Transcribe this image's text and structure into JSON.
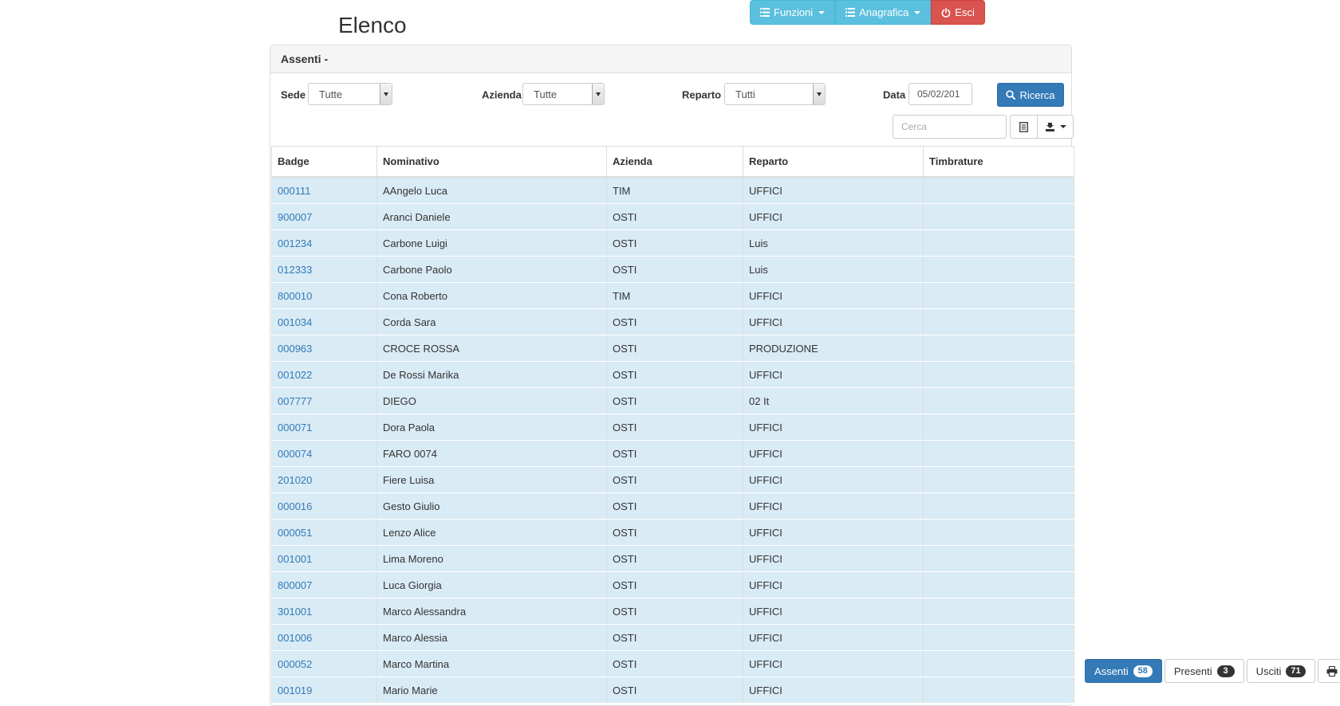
{
  "nav": {
    "funzioni_label": "Funzioni",
    "anagrafica_label": "Anagrafica",
    "esci_label": "Esci"
  },
  "page": {
    "title": "Elenco"
  },
  "panel": {
    "heading": "Assenti -"
  },
  "filters": {
    "sede_label": "Sede",
    "sede_value": "Tutte",
    "azienda_label": "Azienda",
    "azienda_value": "Tutte",
    "reparto_label": "Reparto",
    "reparto_value": "Tutti",
    "data_label": "Data",
    "data_value": "05/02/201",
    "search_button": "Ricerca",
    "cerca_placeholder": "Cerca"
  },
  "table": {
    "columns": [
      "Badge",
      "Nominativo",
      "Azienda",
      "Reparto",
      "Timbrature"
    ],
    "rows": [
      [
        "000111",
        "AAngelo Luca",
        "TIM",
        "UFFICI",
        ""
      ],
      [
        "900007",
        "Aranci Daniele",
        "OSTI",
        "UFFICI",
        ""
      ],
      [
        "001234",
        "Carbone Luigi",
        "OSTI",
        "Luis",
        ""
      ],
      [
        "012333",
        "Carbone Paolo",
        "OSTI",
        "Luis",
        ""
      ],
      [
        "800010",
        "Cona Roberto",
        "TIM",
        "UFFICI",
        ""
      ],
      [
        "001034",
        "Corda Sara",
        "OSTI",
        "UFFICI",
        ""
      ],
      [
        "000963",
        "CROCE ROSSA",
        "OSTI",
        "PRODUZIONE",
        ""
      ],
      [
        "001022",
        "De Rossi Marika",
        "OSTI",
        "UFFICI",
        ""
      ],
      [
        "007777",
        "DIEGO",
        "OSTI",
        "02 It",
        ""
      ],
      [
        "000071",
        "Dora Paola",
        "OSTI",
        "UFFICI",
        ""
      ],
      [
        "000074",
        "FARO 0074",
        "OSTI",
        "UFFICI",
        ""
      ],
      [
        "201020",
        "Fiere Luisa",
        "OSTI",
        "UFFICI",
        ""
      ],
      [
        "000016",
        "Gesto Giulio",
        "OSTI",
        "UFFICI",
        ""
      ],
      [
        "000051",
        "Lenzo Alice",
        "OSTI",
        "UFFICI",
        ""
      ],
      [
        "001001",
        "Lima Moreno",
        "OSTI",
        "UFFICI",
        ""
      ],
      [
        "800007",
        "Luca Giorgia",
        "OSTI",
        "UFFICI",
        ""
      ],
      [
        "301001",
        "Marco Alessandra",
        "OSTI",
        "UFFICI",
        ""
      ],
      [
        "001006",
        "Marco Alessia",
        "OSTI",
        "UFFICI",
        ""
      ],
      [
        "000052",
        "Marco Martina",
        "OSTI",
        "UFFICI",
        ""
      ],
      [
        "001019",
        "Mario Marie",
        "OSTI",
        "UFFICI",
        ""
      ]
    ]
  },
  "bottom_bar": {
    "assenti_label": "Assenti",
    "assenti_count": "58",
    "presenti_label": "Presenti",
    "presenti_count": "3",
    "usciti_label": "Usciti",
    "usciti_count": "71"
  },
  "icons": {
    "funzioni": "list-icon",
    "anagrafica": "list-icon",
    "esci": "power-icon",
    "ricerca": "search-icon",
    "tool_first": "document-icon",
    "tool_second": "export-icon",
    "print": "print-icon"
  },
  "colors": {
    "primary": "#337ab7",
    "info": "#5bc0de",
    "danger": "#d9534f",
    "row_background": "#d9ebf5",
    "link": "#337ab7"
  }
}
